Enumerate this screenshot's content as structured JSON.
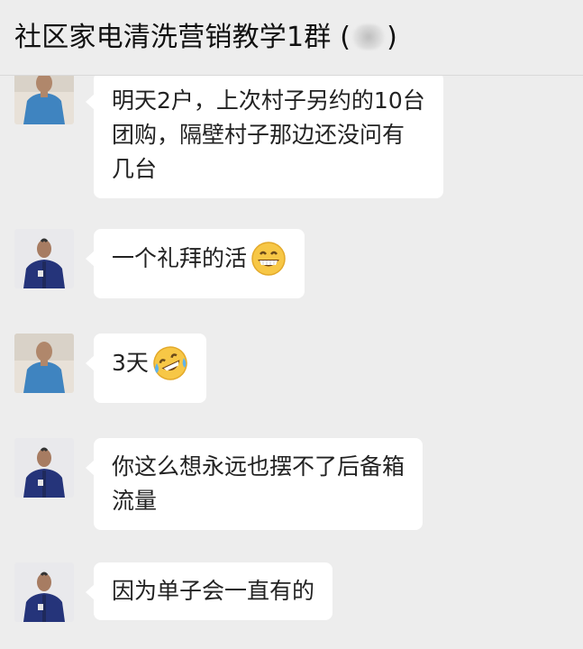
{
  "header": {
    "title": "社区家电清洗营销教学1群 (",
    "title_close": ")"
  },
  "messages": [
    {
      "sender_avatar": "avatar-blue-shirt",
      "lines": [
        "明天2户，上次村子另约的10台",
        "团购，隔壁村子那边还没问有",
        "几台"
      ]
    },
    {
      "sender_avatar": "avatar-dark-jacket",
      "lines": [
        "一个礼拜的活"
      ],
      "emoji": "grinning-face-icon"
    },
    {
      "sender_avatar": "avatar-blue-shirt",
      "lines": [
        "3天"
      ],
      "emoji": "rolling-laughing-face-icon"
    },
    {
      "sender_avatar": "avatar-dark-jacket",
      "lines": [
        "你这么想永远也摆不了后备箱",
        "流量"
      ]
    },
    {
      "sender_avatar": "avatar-dark-jacket",
      "lines": [
        "因为单子会一直有的"
      ]
    }
  ],
  "colors": {
    "background": "#ededed",
    "bubble": "#ffffff",
    "text": "#222222"
  }
}
